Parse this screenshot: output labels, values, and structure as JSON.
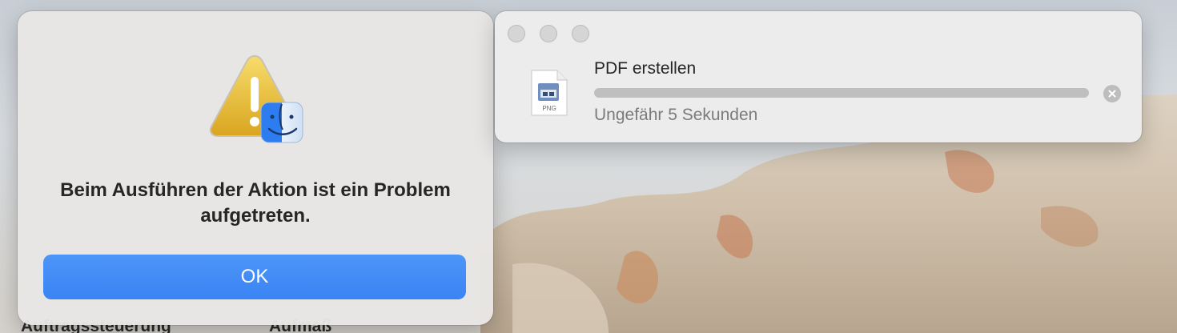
{
  "desktop": {
    "dock_labels": [
      "Auftragssteuerung",
      "Aufmaß"
    ]
  },
  "alert": {
    "icon": "warning-triangle-finder-icon",
    "message": "Beim Ausführen der Aktion ist ein Problem aufgetreten.",
    "ok_label": "OK",
    "accent_color": "#3a84f4"
  },
  "progress": {
    "file_icon": "png-file-icon",
    "file_type_label": "PNG",
    "title": "PDF erstellen",
    "status": "Ungefähr 5 Sekunden",
    "fraction": 0.0,
    "cancel_icon": "close-circle-icon"
  }
}
